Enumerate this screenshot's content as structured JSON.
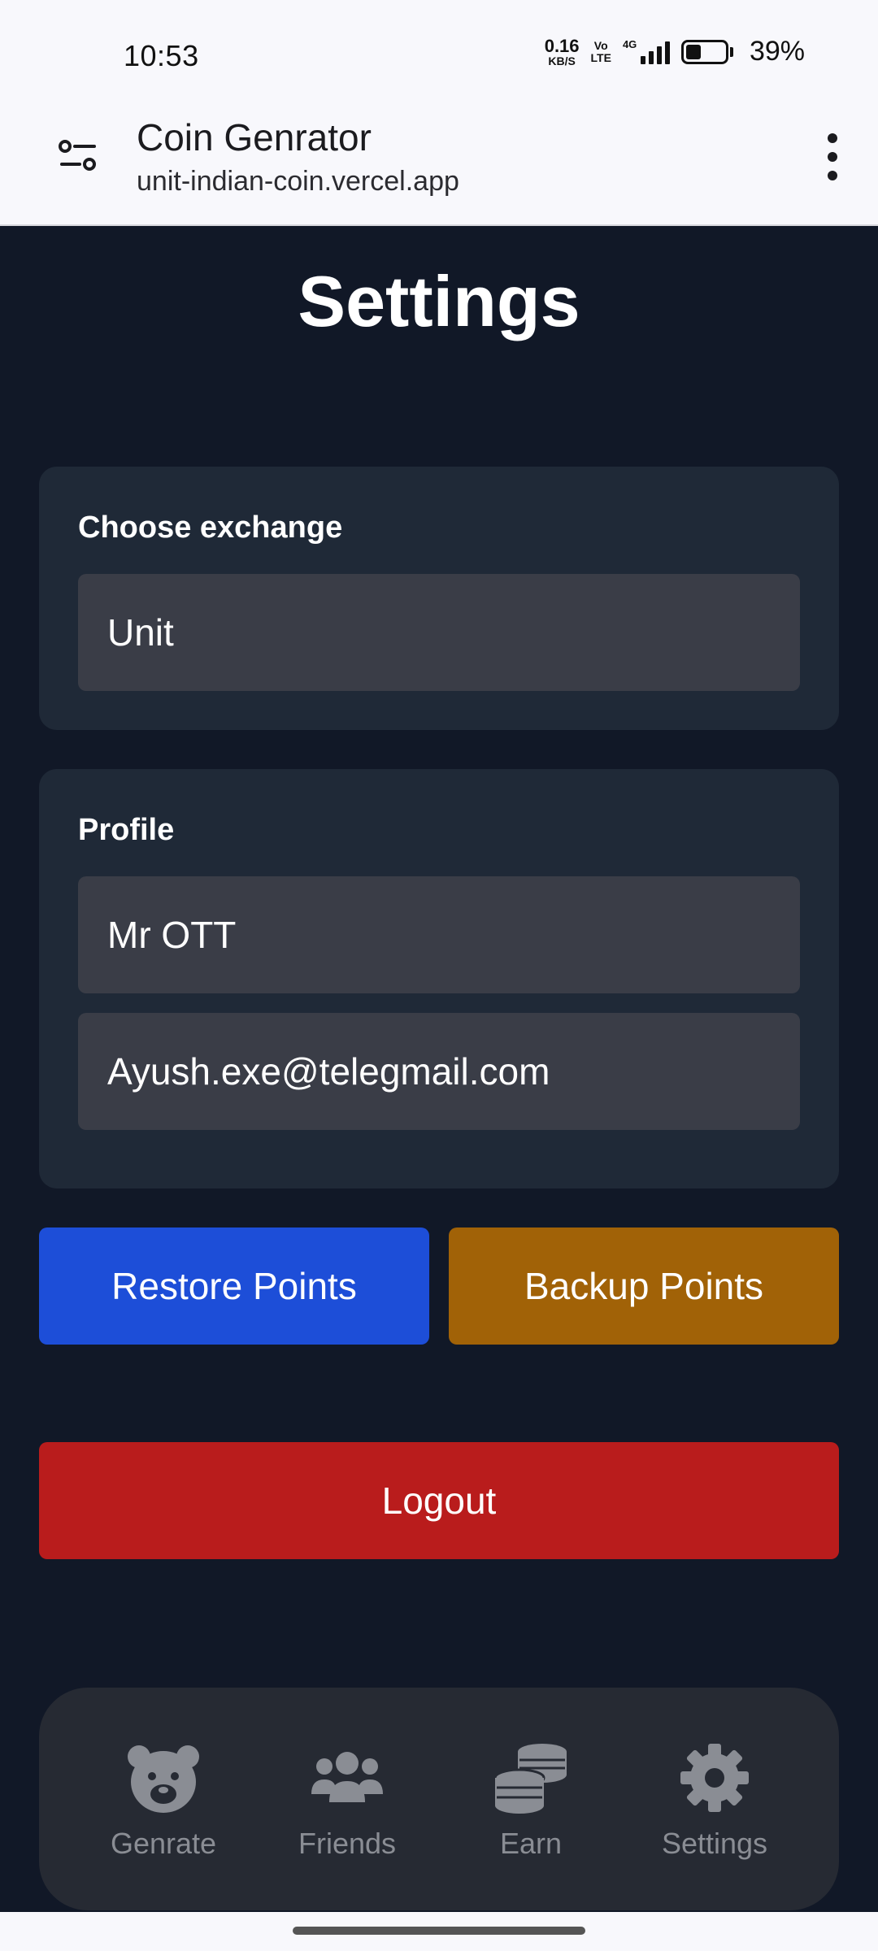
{
  "status": {
    "time": "10:53",
    "net_speed_value": "0.16",
    "net_speed_unit": "KB/S",
    "volte_top": "Vo",
    "volte_bottom": "LTE",
    "network": "4G",
    "battery": "39%",
    "battery_level": 0.39
  },
  "browser": {
    "title": "Coin Genrator",
    "url": "unit-indian-coin.vercel.app"
  },
  "page": {
    "title": "Settings"
  },
  "exchange": {
    "label": "Choose exchange",
    "value": "Unit"
  },
  "profile": {
    "label": "Profile",
    "name": "Mr OTT",
    "email": "Ayush.exe@telegmail.com"
  },
  "actions": {
    "restore": "Restore Points",
    "backup": "Backup Points",
    "logout": "Logout"
  },
  "colors": {
    "restore": "#1d4ed8",
    "backup": "#a16207",
    "logout": "#b91c1c"
  },
  "nav": {
    "items": [
      {
        "label": "Genrate",
        "icon": "bear-face-icon"
      },
      {
        "label": "Friends",
        "icon": "users-icon"
      },
      {
        "label": "Earn",
        "icon": "coins-icon"
      },
      {
        "label": "Settings",
        "icon": "gear-icon"
      }
    ]
  }
}
